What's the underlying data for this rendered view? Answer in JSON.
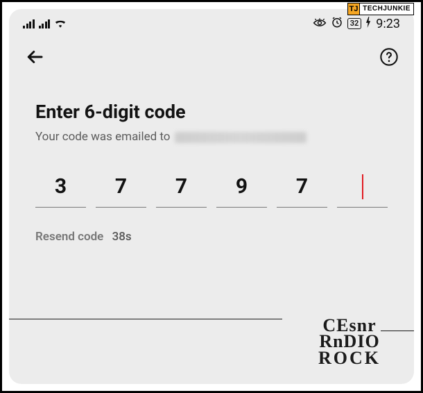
{
  "status_bar": {
    "battery_percent": "32",
    "time": "9:23"
  },
  "nav": {
    "back_label": "Back",
    "help_label": "Help"
  },
  "verify": {
    "title": "Enter 6-digit code",
    "subtitle_prefix": "Your code was emailed to",
    "digits": [
      "3",
      "7",
      "7",
      "9",
      "7",
      ""
    ],
    "active_index": 5,
    "resend_label": "Resend code",
    "resend_countdown": "38s"
  },
  "badges": {
    "techjunkie_icon": "TJ",
    "techjunkie_text": "TECHJUNKIE",
    "watermark_line1": "CEsnr",
    "watermark_line2": "RnDIO",
    "watermark_line3": "ROCK"
  }
}
